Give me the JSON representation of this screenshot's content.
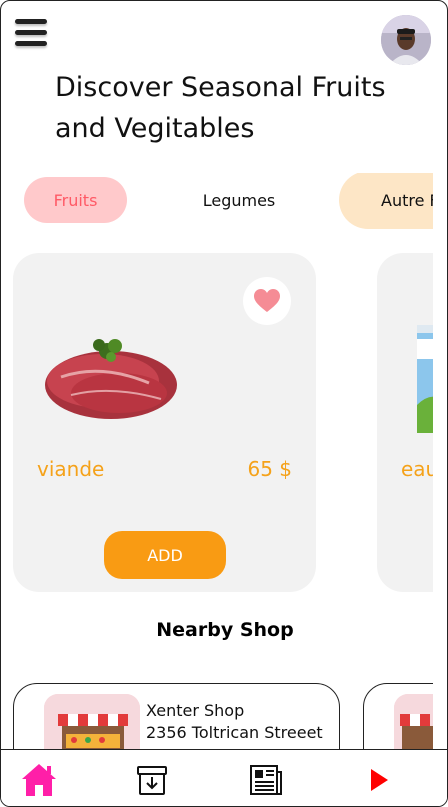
{
  "header": {
    "title": "Discover Seasonal Fruits and Vegitables"
  },
  "categories": [
    {
      "label": "Fruits"
    },
    {
      "label": "Legumes"
    },
    {
      "label": "Autre F"
    }
  ],
  "products": [
    {
      "name": "viande",
      "price": "65 $",
      "add_label": "ADD"
    },
    {
      "name": "eau"
    }
  ],
  "nearby": {
    "title": "Nearby Shop",
    "shops": [
      {
        "name": "Xenter Shop",
        "address": "2356 Toltrican Streeet"
      }
    ]
  },
  "colors": {
    "accent": "#f99b13",
    "price": "#f5a21a",
    "fruits_chip_bg": "#ffc9cb",
    "fruits_chip_text": "#ff5a66",
    "autre_chip_bg": "#fde6c6",
    "home_icon": "#ff1fa8",
    "play_icon": "#ff0000"
  },
  "icons": [
    "menu-icon",
    "heart-icon",
    "home-icon",
    "archive-icon",
    "newspaper-icon",
    "play-icon"
  ]
}
